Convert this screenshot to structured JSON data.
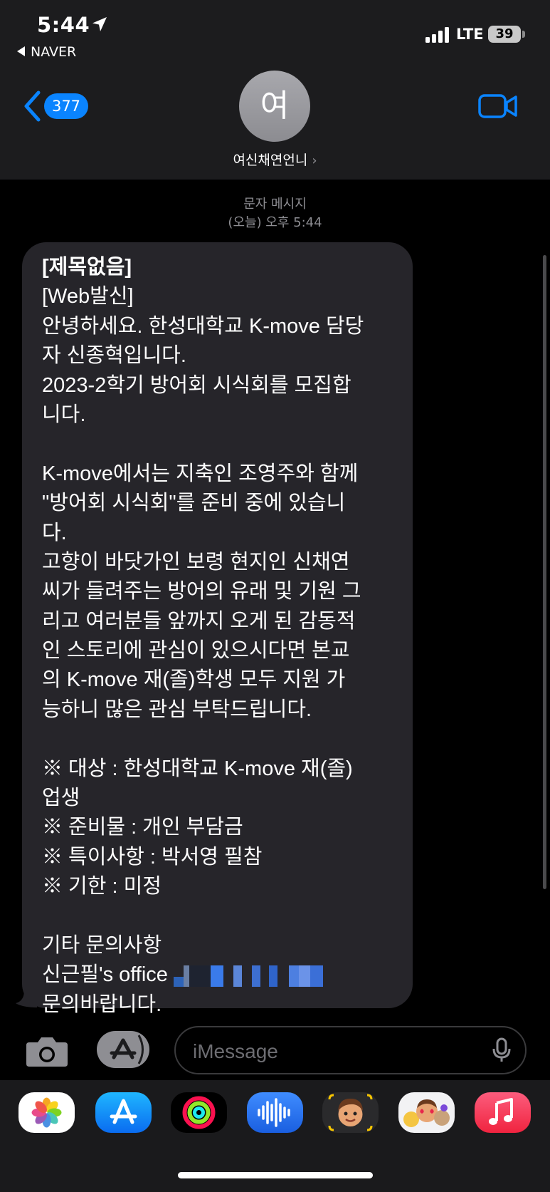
{
  "status_bar": {
    "time": "5:44",
    "back_app": "NAVER",
    "network": "LTE",
    "battery": "39"
  },
  "nav": {
    "back_badge": "377",
    "avatar_initial": "여",
    "contact_name": "여신채연언니",
    "contact_chevron": "›"
  },
  "conversation": {
    "meta_type": "문자 메시지",
    "meta_time": "(오늘) 오후 5:44",
    "message_lines": [
      "[제목없음]",
      "[Web발신]",
      "안녕하세요. 한성대학교 K-move 담당",
      "자 신종혁입니다.",
      "2023-2학기 방어회 시식회를 모집합",
      "니다.",
      "",
      "K-move에서는 지축인 조영주와 함께",
      "\"방어회 시식회\"를 준비 중에 있습니",
      "다.",
      "고향이 바닷가인 보령 현지인 신채연",
      "씨가 들려주는 방어의 유래 및 기원 그",
      "리고 여러분들 앞까지 오게 된 감동적",
      "인 스토리에 관심이 있으시다면 본교",
      "의 K-move 재(졸)학생 모두 지원 가",
      "능하니 많은 관심 부탁드립니다.",
      "",
      "※ 대상 : 한성대학교 K-move 재(졸)",
      "업생",
      "※ 준비물 : 개인 부담금",
      "※ 특이사항 : 박서영 필참",
      "※ 기한 : 미정",
      "",
      "기타 문의사항",
      "신근필's office",
      "문의바랍니다."
    ]
  },
  "input_bar": {
    "placeholder": "iMessage"
  },
  "dock": {
    "apps": [
      "photos-app",
      "app-store-app",
      "activity-app",
      "voice-memos-app",
      "memoji-app",
      "memoji-stickers-app",
      "music-app"
    ]
  },
  "colors": {
    "accent": "#0a84ff",
    "bubble": "#26252a",
    "header": "#1c1c1e"
  }
}
